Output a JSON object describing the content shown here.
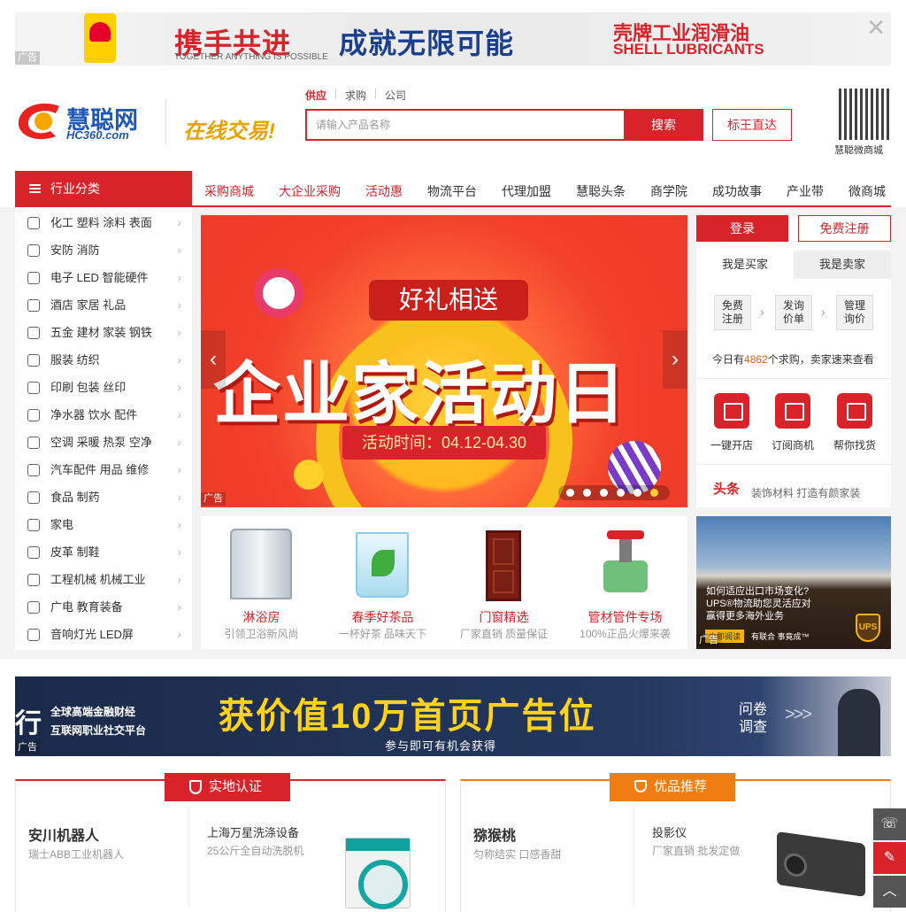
{
  "top_ad": {
    "headline1": "携手共进",
    "headline2": "成就无限可能",
    "brand1": "壳牌工业润滑油",
    "brand2": "SHELL LUBRICANTS",
    "tagline": "TOGETHER ANYTHING IS POSSIBLE",
    "ad_label": "广告",
    "close": "✕"
  },
  "header": {
    "logo_name": "慧聪网",
    "logo_url": "HC360.com",
    "slogan": "在线交易!",
    "search_tabs": [
      "供应",
      "求购",
      "公司"
    ],
    "search_placeholder": "请输入产品名称",
    "search_button": "搜索",
    "biaowang_button": "标王直达",
    "qr_caption": "慧聪微商城"
  },
  "category_header": "行业分类",
  "nav": [
    "采购商城",
    "大企业采购",
    "活动惠",
    "物流平台",
    "代理加盟",
    "慧聪头条",
    "商学院",
    "成功故事",
    "产业带",
    "微商城"
  ],
  "categories": [
    "化工 塑料 涂料 表面",
    "安防 消防",
    "电子 LED 智能硬件",
    "酒店 家居 礼品",
    "五金 建材 家装 钢铁",
    "服装 纺织",
    "印刷 包装 丝印",
    "净水器 饮水 配件",
    "空调 采暖 热泵 空净",
    "汽车配件 用品 维修",
    "食品 制药",
    "家电",
    "皮革 制鞋",
    "工程机械 机械工业",
    "广电 教育装备",
    "音响灯光 LED屏"
  ],
  "banner": {
    "badge": "好礼相送",
    "title": "企业家活动日",
    "date": "活动时间：04.12-04.30",
    "ad_label": "广告",
    "prev": "‹",
    "next": "›"
  },
  "products": [
    {
      "title": "淋浴房",
      "subtitle": "引领卫浴新风尚"
    },
    {
      "title": "春季好茶品",
      "subtitle": "一杯好茶 品味天下"
    },
    {
      "title": "门窗精选",
      "subtitle": "厂家直销 质量保证"
    },
    {
      "title": "管材管件专场",
      "subtitle": "100%正品火爆来袭"
    }
  ],
  "user_panel": {
    "login": "登录",
    "register": "免费注册",
    "tab_buyer": "我是买家",
    "tab_seller": "我是卖家",
    "steps": [
      "免费注册",
      "发询价单",
      "管理询价"
    ],
    "today_prefix": "今日有",
    "today_count": "4862",
    "today_suffix": "个求购，卖家速来查看",
    "services": [
      "一键开店",
      "订阅商机",
      "帮你找货"
    ],
    "news_tag": "头条",
    "news_text": "装饰材料 打造有颜家装"
  },
  "ups_ad": {
    "line1": "如何适应出口市场变化?",
    "line2": "UPS®物流助您灵活应对",
    "line3": "赢得更多海外业务",
    "button": "立即阅读",
    "slogan": "有联合 事竟成™",
    "logo": "UPS",
    "ad_label": "广告"
  },
  "mid_ad": {
    "mark": "行",
    "line1": "全球高端金融财经",
    "line2": "互联网职业社交平台",
    "headline": "获价值10万首页广告位",
    "sub": "参与即可有机会获得",
    "qa1": "问卷",
    "qa2": "调查",
    "arrows": ">>>",
    "ad_label": "广告"
  },
  "sections": [
    {
      "tag": "实地认证",
      "brand": "安川机器人",
      "brand_sub": "瑞士ABB工业机器人",
      "item": "上海万星洗涤设备",
      "item_sub": "25公斤全自动洗脱机"
    },
    {
      "tag": "优品推荐",
      "brand": "猕猴桃",
      "brand_sub": "匀称结实 口感香甜",
      "item": "投影仪",
      "item_sub": "厂家直销 批发定做"
    }
  ],
  "colors": {
    "brand_red": "#d9232a",
    "tag_orange": "#f07d12"
  }
}
